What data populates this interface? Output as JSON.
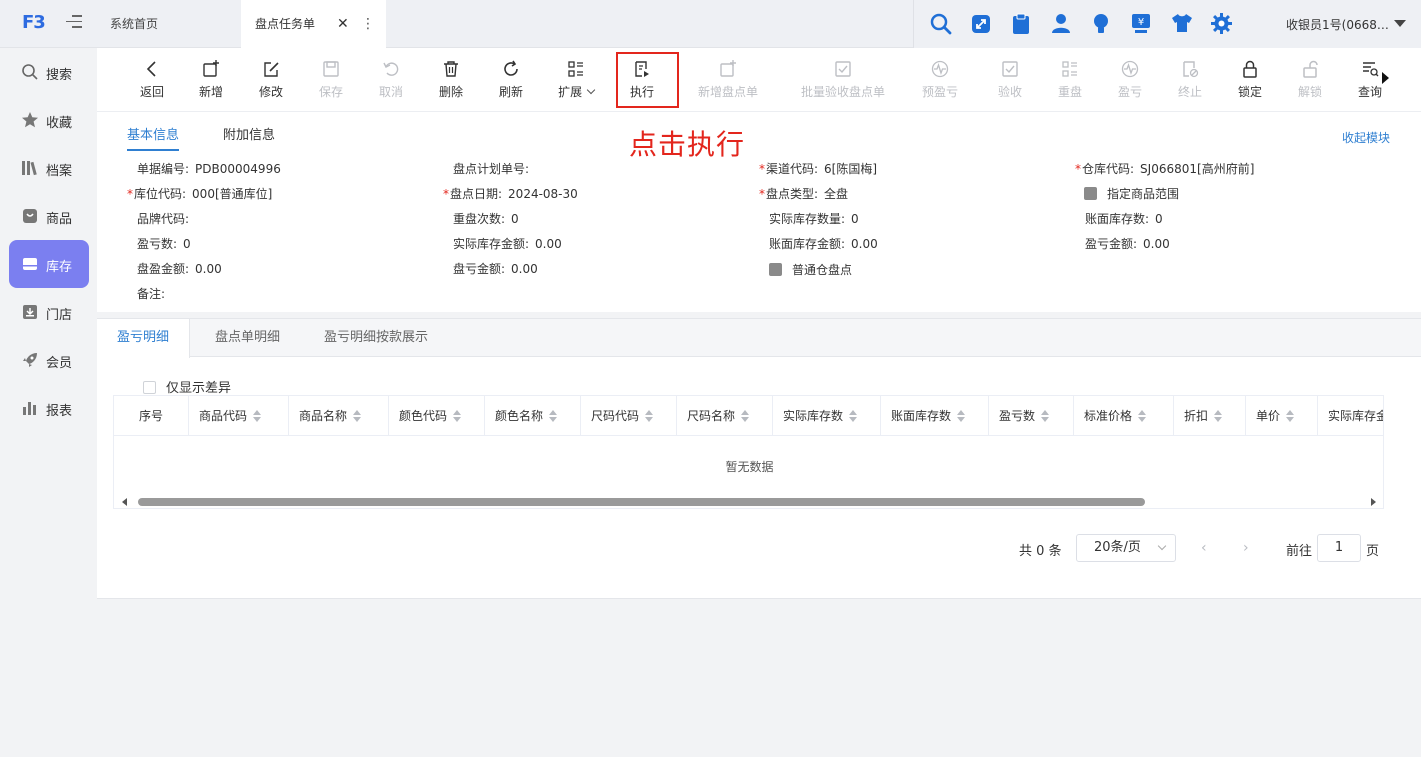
{
  "app": {
    "logo": "F3"
  },
  "tabs": [
    {
      "label": "系统首页"
    },
    {
      "label": "盘点任务单",
      "close": "✕",
      "more": "⋮"
    }
  ],
  "header": {
    "user": "收银员1号(0668…"
  },
  "sidebar": {
    "items": [
      {
        "label": "搜索",
        "icon": "search-icon"
      },
      {
        "label": "收藏",
        "icon": "star-icon"
      },
      {
        "label": "档案",
        "icon": "books-icon"
      },
      {
        "label": "商品",
        "icon": "goods-icon"
      },
      {
        "label": "库存",
        "icon": "inventory-icon",
        "active": true
      },
      {
        "label": "门店",
        "icon": "store-icon"
      },
      {
        "label": "会员",
        "icon": "rocket-icon"
      },
      {
        "label": "报表",
        "icon": "chart-icon"
      }
    ]
  },
  "toolbar": {
    "back": "返回",
    "add": "新增",
    "edit": "修改",
    "save": "保存",
    "cancel": "取消",
    "delete": "删除",
    "refresh": "刷新",
    "expand": "扩展",
    "execute": "执行",
    "new_check": "新增盘点单",
    "batch_accept": "批量验收盘点单",
    "pre_profit": "预盈亏",
    "accept": "验收",
    "recheck": "重盘",
    "profit_loss": "盈亏",
    "terminate": "终止",
    "lock": "锁定",
    "unlock": "解锁",
    "query": "查询"
  },
  "annotation": "点击执行",
  "info": {
    "tab_basic": "基本信息",
    "tab_extra": "附加信息",
    "collapse": "收起模块",
    "doc_no_label": "单据编号:",
    "doc_no": "PDB00004996",
    "plan_no_label": "盘点计划单号:",
    "channel_label": "渠道代码:",
    "channel": "6[陈国梅]",
    "warehouse_label": "仓库代码:",
    "warehouse": "SJ066801[高州府前]",
    "location_label": "库位代码:",
    "location": "000[普通库位]",
    "date_label": "盘点日期:",
    "date": "2024-08-30",
    "type_label": "盘点类型:",
    "type": "全盘",
    "specify_range": "指定商品范围",
    "brand_label": "品牌代码:",
    "recheck_times_label": "重盘次数:",
    "recheck_times": "0",
    "actual_qty_label": "实际库存数量:",
    "actual_qty": "0",
    "book_qty_label": "账面库存数:",
    "book_qty": "0",
    "loss_qty_label": "盈亏数:",
    "loss_qty": "0",
    "actual_amount_label": "实际库存金额:",
    "actual_amount": "0.00",
    "book_amount_label": "账面库存金额:",
    "book_amount": "0.00",
    "loss_amount_label": "盈亏金额:",
    "loss_amount": "0.00",
    "surplus_amount_label": "盘盈金额:",
    "surplus_amount": "0.00",
    "deficit_amount_label": "盘亏金额:",
    "deficit_amount": "0.00",
    "normal_check": "普通仓盘点",
    "remark_label": "备注:"
  },
  "detail": {
    "tabs": [
      "盈亏明细",
      "盘点单明细",
      "盈亏明细按款展示"
    ],
    "diff_only": "仅显示差异",
    "columns": [
      "序号",
      "商品代码",
      "商品名称",
      "颜色代码",
      "颜色名称",
      "尺码代码",
      "尺码名称",
      "实际库存数",
      "账面库存数",
      "盈亏数",
      "标准价格",
      "折扣",
      "单价",
      "实际库存金"
    ],
    "empty": "暂无数据"
  },
  "pager": {
    "total": "共 0 条",
    "page_size": "20条/页",
    "goto": "前往",
    "page": "1",
    "page_unit": "页",
    "prev": "‹",
    "next": "›"
  },
  "colors": {
    "accent": "#2f7fd1",
    "active_side": "#7b7ff0",
    "highlight": "#e3261d",
    "icon_blue": "#1f6fd6"
  }
}
